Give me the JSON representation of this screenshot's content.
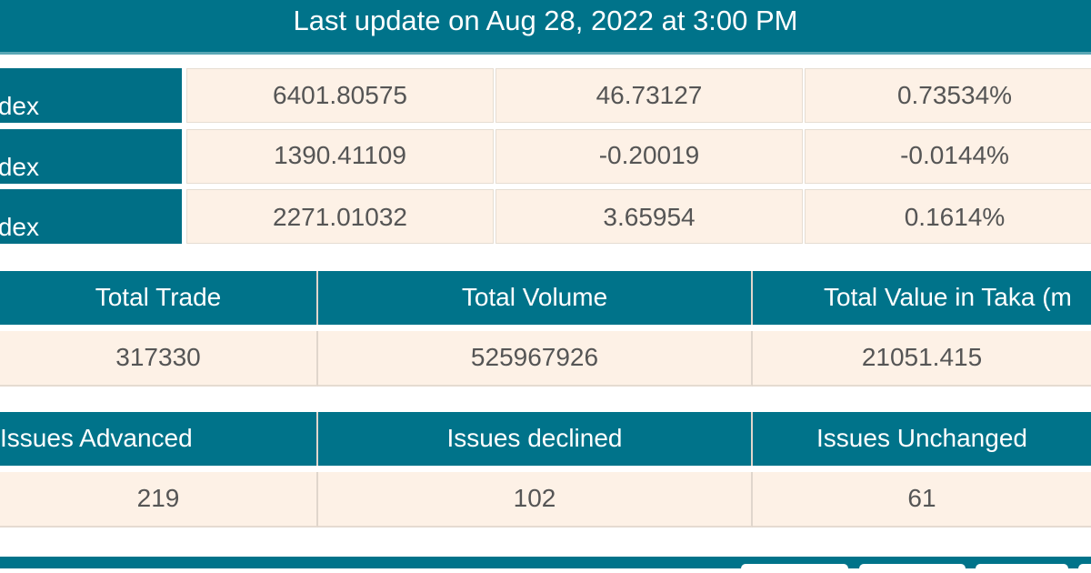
{
  "header": {
    "title": "Last update on Aug 28, 2022 at 3:00 PM"
  },
  "indices": [
    {
      "label": "ndex",
      "value": "6401.80575",
      "change": "46.73127",
      "percent": "0.73534%"
    },
    {
      "label": "ndex",
      "value": "1390.41109",
      "change": "-0.20019",
      "percent": "-0.0144%"
    },
    {
      "label": "dex",
      "value": "2271.01032",
      "change": "3.65954",
      "percent": "0.1614%"
    }
  ],
  "trade": {
    "headers": [
      "Total Trade",
      "Total Volume",
      "Total Value in Taka (m"
    ],
    "values": [
      "317330",
      "525967926",
      "21051.415"
    ]
  },
  "issues": {
    "headers": [
      "Issues Advanced",
      "Issues declined",
      "Issues Unchanged"
    ],
    "values": [
      "219",
      "102",
      "61"
    ]
  }
}
